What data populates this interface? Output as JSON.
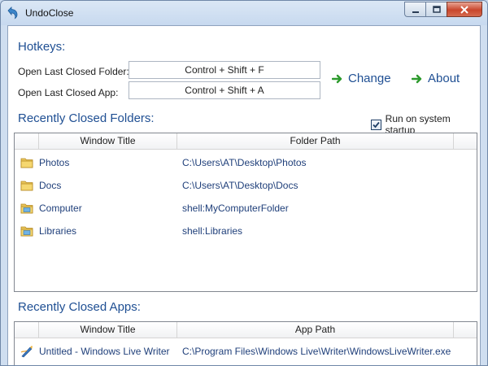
{
  "window": {
    "title": "UndoClose"
  },
  "hotkeys": {
    "section_title": "Hotkeys:",
    "folder_label": "Open Last Closed Folder:",
    "folder_value": "Control + Shift + F",
    "app_label": "Open Last Closed App:",
    "app_value": "Control + Shift + A",
    "change_label": "Change",
    "about_label": "About"
  },
  "folders": {
    "section_title": "Recently Closed Folders:",
    "startup_label": "Run on system startup",
    "startup_checked": true,
    "columns": [
      "Window Title",
      "Folder Path"
    ],
    "rows": [
      {
        "icon": "folder-icon",
        "title": "Photos",
        "path": "C:\\Users\\AT\\Desktop\\Photos"
      },
      {
        "icon": "folder-icon",
        "title": "Docs",
        "path": "C:\\Users\\AT\\Desktop\\Docs"
      },
      {
        "icon": "special-folder-icon",
        "title": "Computer",
        "path": "shell:MyComputerFolder"
      },
      {
        "icon": "special-folder-icon",
        "title": "Libraries",
        "path": "shell:Libraries"
      }
    ]
  },
  "apps": {
    "section_title": "Recently Closed Apps:",
    "columns": [
      "Window Title",
      "App Path"
    ],
    "rows": [
      {
        "icon": "live-writer-icon",
        "title": "Untitled - Windows Live Writer",
        "path": "C:\\Program Files\\Windows Live\\Writer\\WindowsLiveWriter.exe"
      }
    ]
  },
  "colors": {
    "accent": "#1f4f93",
    "arrow_green": "#2d9a2d"
  }
}
